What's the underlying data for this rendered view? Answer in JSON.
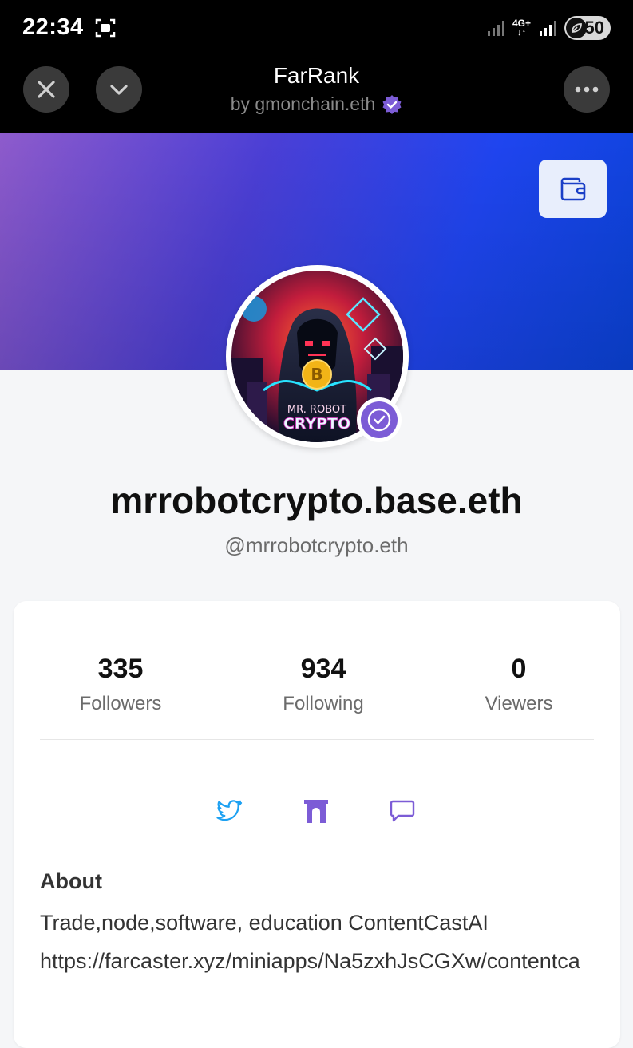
{
  "status_bar": {
    "time": "22:34",
    "network_label": "4G+",
    "battery": "50",
    "icons": [
      "screenshot-icon",
      "signal-icon",
      "signal-icon",
      "battery-saver-icon"
    ]
  },
  "app_header": {
    "title": "FarRank",
    "subtitle": "by gmonchain.eth",
    "icons": [
      "close-icon",
      "chevron-down-icon",
      "more-icon",
      "verified-icon"
    ]
  },
  "profile": {
    "avatar_text_top": "MR. ROBOT",
    "avatar_text_bottom": "CRYPTO",
    "avatar_coin": "B",
    "display_name": "mrrobotcrypto.base.eth",
    "handle": "@mrrobotcrypto.eth"
  },
  "stats": [
    {
      "value": "335",
      "label": "Followers"
    },
    {
      "value": "934",
      "label": "Following"
    },
    {
      "value": "0",
      "label": "Viewers"
    }
  ],
  "social_icons": [
    "twitter-icon",
    "gate-icon",
    "message-icon"
  ],
  "about": {
    "title": "About",
    "lines": [
      "Trade,node,software, education ContentCastAI",
      "https://farcaster.xyz/miniapps/Na5zxhJsCGXw/contentca"
    ]
  },
  "colors": {
    "accent_purple": "#7c5cd6",
    "twitter_blue": "#1da1f2",
    "banner_left": "#8e5bcc",
    "banner_right": "#0a43d8"
  }
}
